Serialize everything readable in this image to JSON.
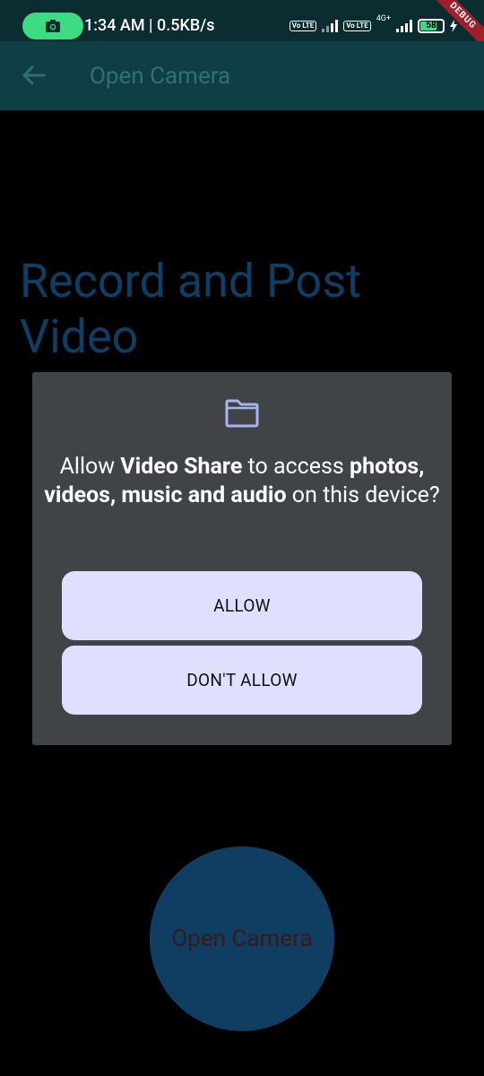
{
  "status_bar": {
    "time_speed": "1:34 AM | 0.5KB/s",
    "volte_1": "Vo LTE",
    "volte_2": "Vo LTE",
    "network": "4G+",
    "battery": "58",
    "debug_banner": "DEBUG",
    "colors": {
      "background": "#0b2c30",
      "recording_pill": "#3ddc84"
    }
  },
  "app_bar": {
    "title": "Open Camera",
    "back_icon": "arrow-left-icon",
    "colors": {
      "background": "#0f3f44",
      "title": "#2f6f78"
    }
  },
  "main": {
    "headline": "Record and Post Video",
    "open_camera_button": "Open Camera",
    "colors": {
      "background": "#000000",
      "headline": "#0f3e62",
      "fab": "#0f3e62"
    }
  },
  "permission_dialog": {
    "icon": "folder-icon",
    "message_prefix": "Allow ",
    "app_name": "Video Share",
    "message_mid": " to access ",
    "resource": "photos, videos, music and audio",
    "message_suffix": " on this device?",
    "allow_label": "ALLOW",
    "deny_label": "DON'T ALLOW",
    "colors": {
      "background": "#414446",
      "button": "#dfe0ff",
      "icon": "#a8b4f0"
    }
  }
}
